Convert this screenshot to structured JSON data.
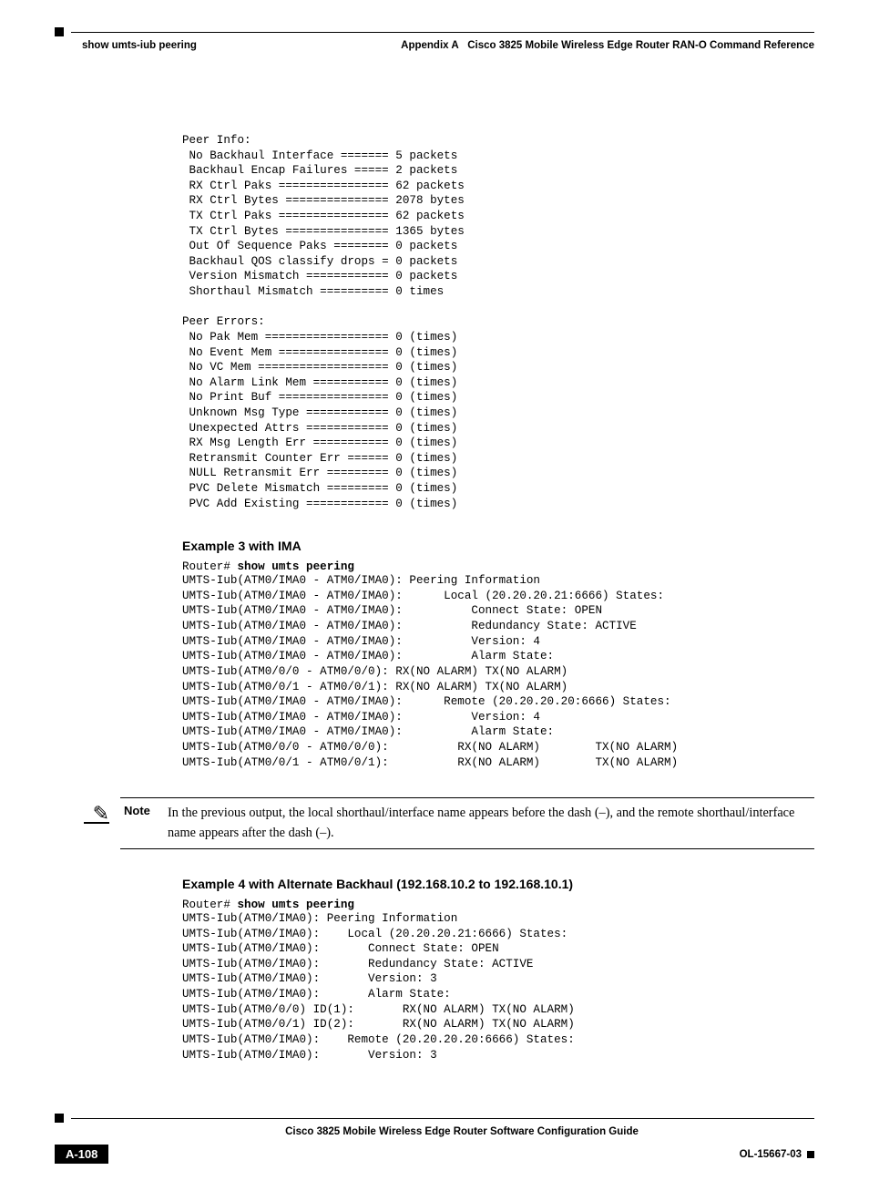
{
  "header": {
    "left": "show umts-iub peering",
    "right_prefix": "Appendix A",
    "right_title": "Cisco 3825 Mobile Wireless Edge Router RAN-O Command Reference"
  },
  "block1": "Peer Info:\n No Backhaul Interface ======= 5 packets\n Backhaul Encap Failures ===== 2 packets\n RX Ctrl Paks ================ 62 packets\n RX Ctrl Bytes =============== 2078 bytes\n TX Ctrl Paks ================ 62 packets\n TX Ctrl Bytes =============== 1365 bytes\n Out Of Sequence Paks ======== 0 packets\n Backhaul QOS classify drops = 0 packets\n Version Mismatch ============ 0 packets\n Shorthaul Mismatch ========== 0 times\n\nPeer Errors:\n No Pak Mem ================== 0 (times)\n No Event Mem ================ 0 (times)\n No VC Mem =================== 0 (times)\n No Alarm Link Mem =========== 0 (times)\n No Print Buf ================ 0 (times)\n Unknown Msg Type ============ 0 (times)\n Unexpected Attrs ============ 0 (times)\n RX Msg Length Err =========== 0 (times)\n Retransmit Counter Err ====== 0 (times)\n NULL Retransmit Err ========= 0 (times)\n PVC Delete Mismatch ========= 0 (times)\n PVC Add Existing ============ 0 (times)",
  "ex3": {
    "heading": "Example 3 with IMA",
    "prompt": "Router# ",
    "cmd": "show umts peering",
    "output": "UMTS-Iub(ATM0/IMA0 - ATM0/IMA0): Peering Information\nUMTS-Iub(ATM0/IMA0 - ATM0/IMA0):      Local (20.20.20.21:6666) States:\nUMTS-Iub(ATM0/IMA0 - ATM0/IMA0):          Connect State: OPEN\nUMTS-Iub(ATM0/IMA0 - ATM0/IMA0):          Redundancy State: ACTIVE\nUMTS-Iub(ATM0/IMA0 - ATM0/IMA0):          Version: 4\nUMTS-Iub(ATM0/IMA0 - ATM0/IMA0):          Alarm State:\nUMTS-Iub(ATM0/0/0 - ATM0/0/0): RX(NO ALARM) TX(NO ALARM)\nUMTS-Iub(ATM0/0/1 - ATM0/0/1): RX(NO ALARM) TX(NO ALARM)\nUMTS-Iub(ATM0/IMA0 - ATM0/IMA0):      Remote (20.20.20.20:6666) States:\nUMTS-Iub(ATM0/IMA0 - ATM0/IMA0):          Version: 4\nUMTS-Iub(ATM0/IMA0 - ATM0/IMA0):          Alarm State:\nUMTS-Iub(ATM0/0/0 - ATM0/0/0):          RX(NO ALARM)        TX(NO ALARM)\nUMTS-Iub(ATM0/0/1 - ATM0/0/1):          RX(NO ALARM)        TX(NO ALARM)"
  },
  "note": {
    "label": "Note",
    "text": "In the previous output, the local shorthaul/interface name appears before the dash (–), and the remote shorthaul/interface name appears after the dash (–)."
  },
  "ex4": {
    "heading": "Example 4 with Alternate Backhaul (192.168.10.2 to 192.168.10.1)",
    "prompt": "Router# ",
    "cmd": "show umts peering",
    "output": "UMTS-Iub(ATM0/IMA0): Peering Information\nUMTS-Iub(ATM0/IMA0):    Local (20.20.20.21:6666) States:\nUMTS-Iub(ATM0/IMA0):       Connect State: OPEN\nUMTS-Iub(ATM0/IMA0):       Redundancy State: ACTIVE\nUMTS-Iub(ATM0/IMA0):       Version: 3\nUMTS-Iub(ATM0/IMA0):       Alarm State:\nUMTS-Iub(ATM0/0/0) ID(1):       RX(NO ALARM) TX(NO ALARM)\nUMTS-Iub(ATM0/0/1) ID(2):       RX(NO ALARM) TX(NO ALARM)\nUMTS-Iub(ATM0/IMA0):    Remote (20.20.20.20:6666) States:\nUMTS-Iub(ATM0/IMA0):       Version: 3"
  },
  "footer": {
    "book_title": "Cisco 3825 Mobile Wireless Edge Router Software Configuration Guide",
    "page_number": "A-108",
    "doc_code": "OL-15667-03"
  }
}
